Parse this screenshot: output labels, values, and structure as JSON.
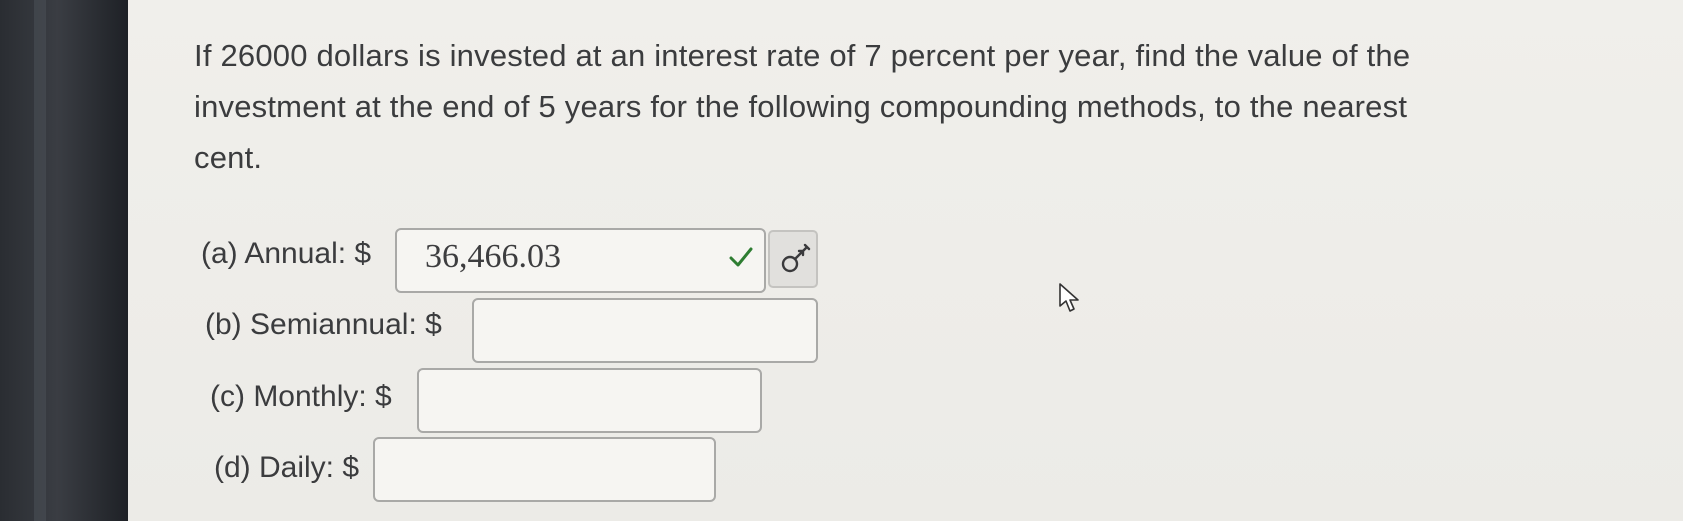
{
  "question": {
    "line1": "If 26000 dollars is invested at an interest rate of 7 percent per year, find the value of the",
    "line2": "investment at the end of 5 years for the following compounding methods, to the nearest",
    "line3": "cent."
  },
  "parts": {
    "annual": {
      "label": "(a) Annual: $",
      "value": "36,466.03",
      "status": "correct"
    },
    "semiannual": {
      "label": "(b) Semiannual: $",
      "value": ""
    },
    "monthly": {
      "label": "(c) Monthly: $",
      "value": ""
    },
    "daily": {
      "label": "(d) Daily: $",
      "value": ""
    }
  },
  "icons": {
    "correct": "check-icon",
    "hint": "key-icon"
  },
  "colors": {
    "correct_check": "#2e7d32"
  }
}
